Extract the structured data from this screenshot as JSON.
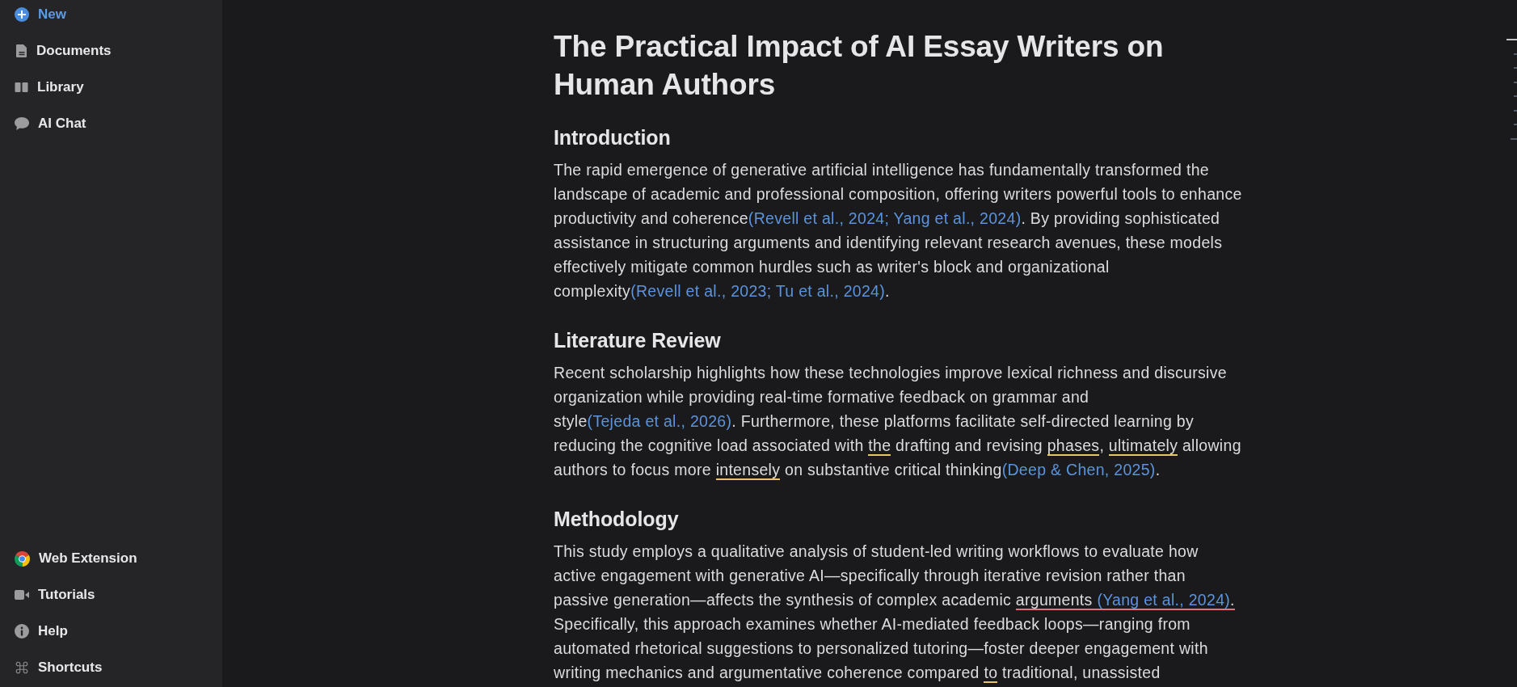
{
  "sidebar": {
    "top_items": [
      {
        "label": "New",
        "kind": "action"
      },
      {
        "label": "Documents",
        "kind": "nav"
      },
      {
        "label": "Library",
        "kind": "nav"
      },
      {
        "label": "AI Chat",
        "kind": "nav"
      }
    ],
    "bottom_items": [
      {
        "label": "Web Extension",
        "kind": "nav"
      },
      {
        "label": "Tutorials",
        "kind": "nav"
      },
      {
        "label": "Help",
        "kind": "nav"
      },
      {
        "label": "Shortcuts",
        "kind": "nav"
      }
    ]
  },
  "document": {
    "title": "The Practical Impact of AI Essay Writers on Human Authors",
    "sections": [
      {
        "heading": "Introduction",
        "paragraph": [
          {
            "kind": "text",
            "text": "The rapid emergence of generative artificial intelligence has fundamentally transformed the landscape of academic and professional composition, offering writers powerful tools to enhance productivity and coherence"
          },
          {
            "kind": "citation",
            "text": "(Revell et al., 2024; Yang et al., 2024)"
          },
          {
            "kind": "text",
            "text": ". By providing sophisticated assistance in structuring arguments and identifying relevant research avenues, these models effectively mitigate common hurdles such as writer's block and organizational complexity"
          },
          {
            "kind": "citation",
            "text": "(Revell et al., 2023; Tu et al., 2024)"
          },
          {
            "kind": "text",
            "text": "."
          }
        ]
      },
      {
        "heading": "Literature Review",
        "paragraph": [
          {
            "kind": "text",
            "text": "Recent scholarship highlights how these technologies improve lexical richness and discursive organization while providing real-time formative feedback on grammar and style"
          },
          {
            "kind": "citation",
            "text": "(Tejeda et al., 2026)"
          },
          {
            "kind": "text",
            "text": ". Furthermore, these platforms facilitate self-directed learning by reducing the cognitive load associated with "
          },
          {
            "kind": "flag",
            "color": "#e8c468",
            "text": "the"
          },
          {
            "kind": "text",
            "text": " drafting and revising "
          },
          {
            "kind": "flag",
            "color": "#e8c468",
            "text": "phases"
          },
          {
            "kind": "text",
            "text": ", "
          },
          {
            "kind": "flag",
            "color": "#e8c468",
            "text": "ultimately"
          },
          {
            "kind": "text",
            "text": " allowing authors to focus more "
          },
          {
            "kind": "flag",
            "color": "#e8c468",
            "text": "intensely"
          },
          {
            "kind": "text",
            "text": " on substantive critical thinking"
          },
          {
            "kind": "citation",
            "text": "(Deep & Chen, 2025)"
          },
          {
            "kind": "text",
            "text": "."
          }
        ]
      },
      {
        "heading": "Methodology",
        "paragraph": [
          {
            "kind": "text",
            "text": "This study employs a qualitative analysis of student-led writing workflows to evaluate how active engagement with generative AI—specifically through iterative revision rather than passive generation—affects the synthesis of complex academic "
          },
          {
            "kind": "flag",
            "color": "#e8707f",
            "parts": [
              {
                "kind": "text",
                "text": "arguments "
              },
              {
                "kind": "citation",
                "text": "(Yang et al., 2024)"
              },
              {
                "kind": "text",
                "text": "."
              }
            ]
          },
          {
            "kind": "text",
            "text": " Specifically, this approach examines whether AI-mediated feedback loops—ranging from automated rhetorical suggestions to personalized tutoring—foster deeper engagement with writing mechanics and argumentative coherence compared "
          },
          {
            "kind": "flag",
            "color": "#e8c468",
            "text": "to"
          },
          {
            "kind": "text",
            "text": " traditional, unassisted"
          }
        ]
      }
    ]
  },
  "outline": [
    {
      "kind": "long",
      "selected": true
    },
    {
      "kind": "short",
      "selected": false
    },
    {
      "kind": "short",
      "selected": false
    },
    {
      "kind": "short",
      "selected": false
    },
    {
      "kind": "short",
      "selected": false
    },
    {
      "kind": "short",
      "selected": false
    },
    {
      "kind": "short",
      "selected": false
    },
    {
      "kind": "medium",
      "selected": false
    }
  ]
}
